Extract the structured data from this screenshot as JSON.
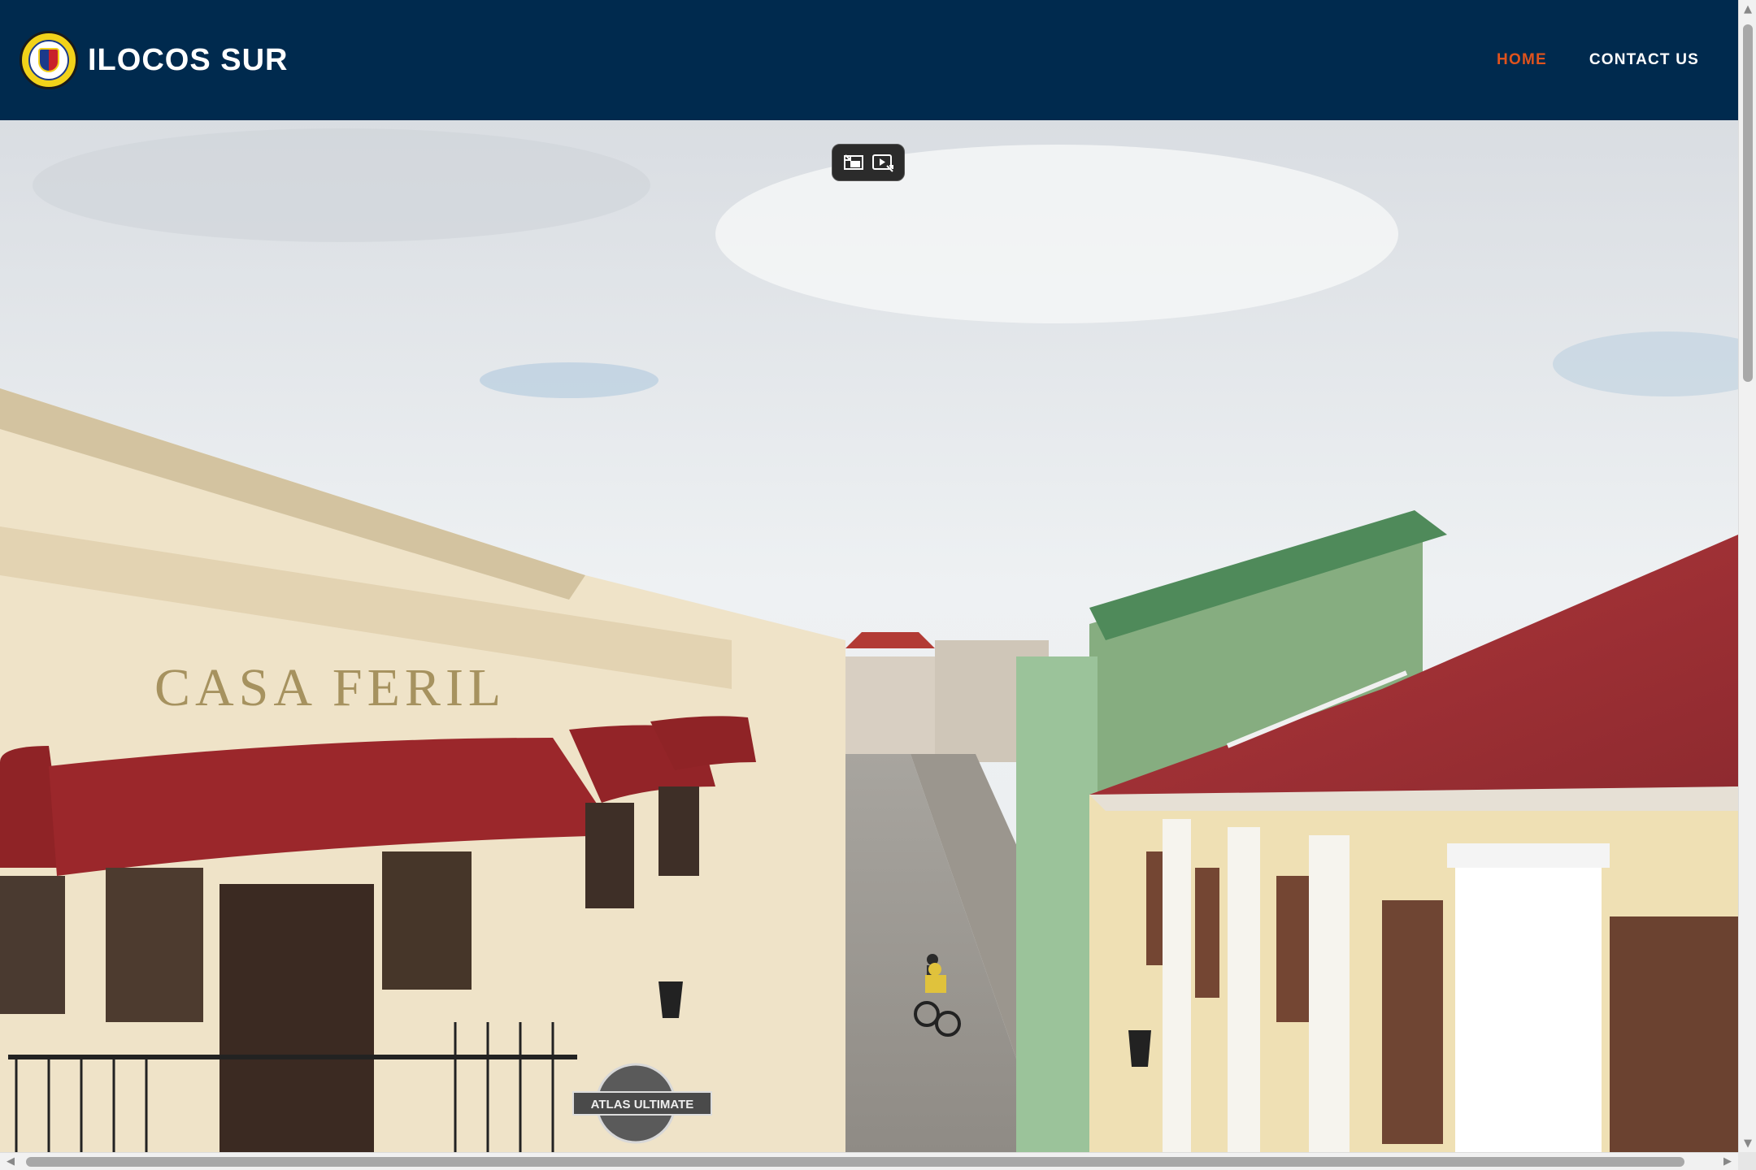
{
  "header": {
    "brand_title": "ILOCOS SUR",
    "logo_icon": "provincial-seal-icon",
    "bg_color": "#002a4e"
  },
  "nav": {
    "items": [
      {
        "label": "HOME",
        "active": true,
        "color": "#e0531d"
      },
      {
        "label": "CONTACT US",
        "active": false,
        "color": "#ffffff"
      }
    ]
  },
  "hero": {
    "signage": {
      "building_name": "CASA FERIL",
      "shop_sign": "ATLAS ULTIMATE"
    },
    "video_controls": {
      "buttons": [
        "exit-fullscreen-icon",
        "picture-in-picture-icon"
      ]
    }
  },
  "scrollbars": {
    "vertical": "visible",
    "horizontal": "visible"
  }
}
